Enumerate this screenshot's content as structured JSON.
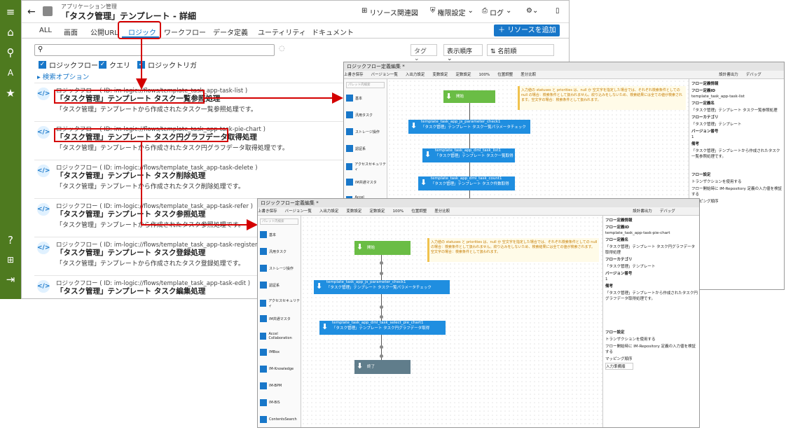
{
  "rail": {
    "icons": [
      "menu-icon",
      "home-icon",
      "search-icon",
      "translate-icon",
      "star-icon",
      "help-icon",
      "sitemap-icon",
      "logout-icon"
    ]
  },
  "header": {
    "breadcrumb": "アプリケーション管理",
    "title": "「タスク管理」テンプレート - 詳細",
    "related": "リソース関連図",
    "perm": "権限設定",
    "log": "ログ"
  },
  "tabs": [
    "ALL",
    "画面",
    "公開URL",
    "ロジック",
    "ワークフロー",
    "データ定義",
    "ユーティリティ",
    "ドキュメント"
  ],
  "add_button": "リソースを追加",
  "filters": {
    "tag": "タグ",
    "display": "表示順序",
    "sort": "名前順",
    "cb1": "ロジックフロー",
    "cb2": "クエリ",
    "cb3": "ロジックトリガ",
    "options": "検索オプション"
  },
  "items": [
    {
      "meta": "ロジックフロー ( ID: im-logic://flows/template_task_app-task-list )",
      "title": "「タスク管理」テンプレート タスク一覧参照処理",
      "desc": "「タスク管理」テンプレートから作成されたタスク一覧参照処理です。"
    },
    {
      "meta": "ロジックフロー ( ID: im-logic://flows/template_task_app-task-pie-chart )",
      "title": "「タスク管理」テンプレート タスク円グラフデータ取得処理",
      "desc": "「タスク管理」テンプレートから作成されたタスク円グラフデータ取得処理です。"
    },
    {
      "meta": "ロジックフロー ( ID: im-logic://flows/template_task_app-task-delete )",
      "title": "「タスク管理」テンプレート タスク削除処理",
      "desc": "「タスク管理」テンプレートから作成されたタスク削除処理です。"
    },
    {
      "meta": "ロジックフロー ( ID: im-logic://flows/template_task_app-task-refer )",
      "title": "「タスク管理」テンプレート タスク参照処理",
      "desc": "「タスク管理」テンプレートから作成されたタスク参照処理です。"
    },
    {
      "meta": "ロジックフロー ( ID: im-logic://flows/template_task_app-task-register )",
      "title": "「タスク管理」テンプレート タスク登録処理",
      "desc": "「タスク管理」テンプレートから作成されたタスク登録処理です。"
    },
    {
      "meta": "ロジックフロー ( ID: im-logic://flows/template_task_app-task-edit )",
      "title": "「タスク管理」テンプレート タスク編集処理",
      "desc": ""
    }
  ],
  "editor": {
    "title": "ロジックフロー定義編集 *",
    "save": "上書き保存",
    "version": "バージョン一覧",
    "io": "入出力設定",
    "vars": "変数設定",
    "consts": "定数設定",
    "zoom": "100%",
    "pos": "位置調整",
    "diff": "差分比較",
    "setting": "設計書出力",
    "debug": "デバッグ",
    "palette": [
      "基本",
      "汎用タスク",
      "ストレージ操作",
      "認証系",
      "アクセスセキュリティ",
      "IM共通マスタ",
      "Accel Collaboration",
      "IMBox",
      "IM-Knowledge",
      "IM-BPM",
      "IM-BIS",
      "ContentsSearch"
    ],
    "start": "開始",
    "end": "終了",
    "palette_search": "パレット内検索"
  },
  "editor1": {
    "node1_id": "template_task_app_js_parameter_check1",
    "node1": "「タスク管理」テンプレート タスク一覧パラメータチェック",
    "node2_id": "template_task_app_dml_task_list1",
    "node2": "「タスク管理」テンプレート タスク一覧取得",
    "node3_id": "template_task_app_dml_task_count1",
    "node3": "「タスク管理」テンプレート タスク件数取得",
    "note": "入力値の statuses と priorities は、null か 空文字を指定した場合では、それぞれ検索条件としての null の場合：検索条件として扱われません。絞り込みをしないため、検索結果には全ての値が検索されます。空文字の場合：検索条件として扱われます。",
    "prop_title": "フロー定義情報",
    "flow_id_label": "フロー定義ID",
    "flow_id": "template_task_app-task-list",
    "name_label": "フロー定義名",
    "name": "「タスク管理」テンプレート タスク一覧参照処理",
    "cat_label": "フローカテゴリ",
    "cat": "「タスク管理」テンプレート",
    "ver_label": "バージョン番号",
    "ver": "1",
    "note_label": "備考",
    "note_val": "「タスク管理」テンプレートから作成されたタスク一覧参照処理です。",
    "setting": "フロー設定",
    "tx": "トランザクションを使用する",
    "mp": "フロー開始時に IM-Repository 定義の入力値を検証する",
    "mapping": "マッピング順序"
  },
  "editor2": {
    "node1_id": "template_task_app_js_parameter_check1",
    "node1": "「タスク管理」テンプレート タスク一覧パラメータチェック",
    "node2_id": "template_task_app_dml_task_select_pie_chart1",
    "node2": "「タスク管理」テンプレート タスク円グラフデータ取得",
    "note": "入力値の statuses と priorities は、null か 空文字を指定した場合では、それぞれ検索条件としての null の場合：検索条件として扱われません。絞り込みをしないため、検索結果には全ての値が検索されます。空文字の場合：検索条件として扱われます。",
    "prop_title": "フロー定義情報",
    "flow_id_label": "フロー定義ID",
    "flow_id": "template_task_app-task-pie-chart",
    "name_label": "フロー定義名",
    "name": "「タスク管理」テンプレート タスク円グラフデータ取得処理",
    "cat_label": "フローカテゴリ",
    "cat": "「タスク管理」テンプレート",
    "ver_label": "バージョン番号",
    "ver": "1",
    "note_label": "備考",
    "note_val": "「タスク管理」テンプレートから作成されたタスク円グラフデータ取得処理です。",
    "setting": "フロー設定",
    "tx": "トランザクションを使用する",
    "mp": "フロー開始時に IM-Repository 定義の入力値を検証する",
    "mapping": "マッピング順序",
    "map_val": "入力準備順"
  },
  "colors": {
    "rail": "#4e7a1f",
    "accent": "#1877c9",
    "start": "#6abd45",
    "end": "#607d8b",
    "highlight": "#d40000"
  }
}
